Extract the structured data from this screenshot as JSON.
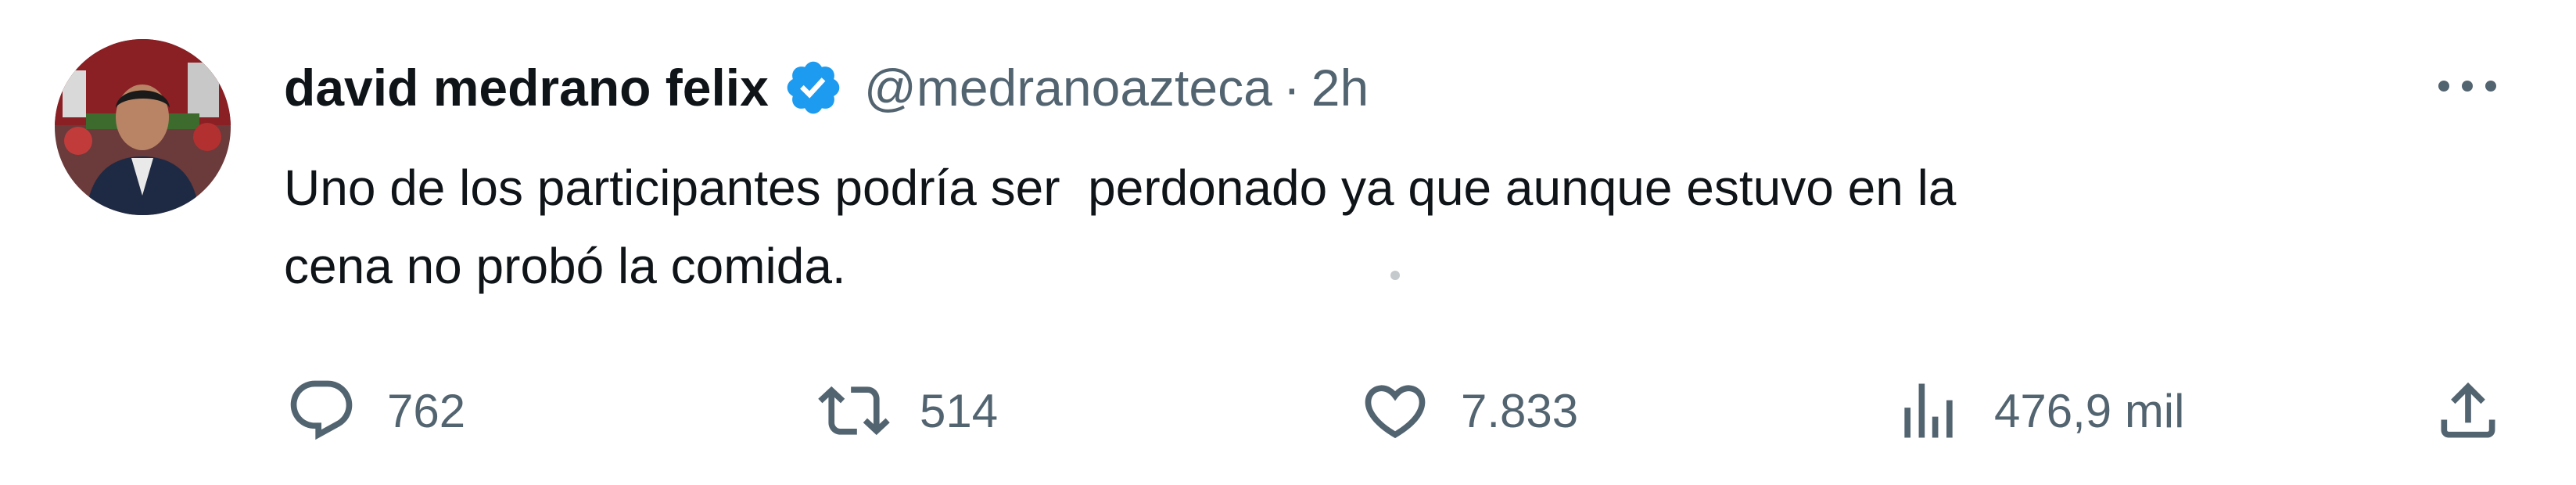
{
  "author": {
    "display_name": "david medrano felix",
    "handle": "@medranoazteca",
    "separator": "·",
    "time": "2h",
    "verified": true
  },
  "tweet": {
    "text": "Uno de los participantes podría ser  perdonado ya que aunque estuvo en la\ncena no probó la comida."
  },
  "actions": {
    "reply_count": "762",
    "retweet_count": "514",
    "like_count": "7.833",
    "views_count": "476,9 mil"
  },
  "icons": {
    "more": "more-horizontal-icon",
    "verified": "verified-badge-icon",
    "reply": "reply-icon",
    "retweet": "retweet-icon",
    "like": "heart-icon",
    "views": "views-chart-icon",
    "share": "share-icon"
  },
  "colors": {
    "text": "#0f1419",
    "secondary": "#536471",
    "verified_blue": "#1d9bf0"
  }
}
